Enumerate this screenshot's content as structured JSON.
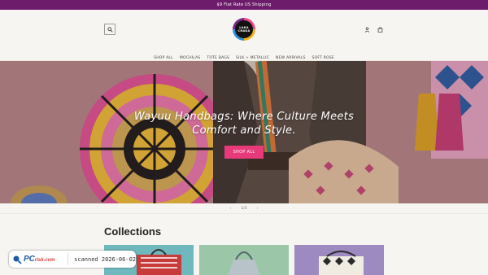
{
  "announcement": "$9 Flat Rate US Shipping",
  "header": {
    "logo_text": [
      "LAKA",
      "CHAKA"
    ],
    "icons": [
      "search-icon",
      "account-icon",
      "cart-icon"
    ]
  },
  "nav": {
    "items": [
      "SHOP ALL",
      "MOCHILAS",
      "TOTE BAGS",
      "SILK + METALLIC",
      "NEW ARRIVALS",
      "SOFT ROSE"
    ]
  },
  "hero": {
    "title_line1": "Wayuu Handbags: Where Culture Meets",
    "title_line2": "Comfort and Style.",
    "button": "SHOP ALL"
  },
  "slider": {
    "prev": "‹",
    "counter": "1/3",
    "next": "›"
  },
  "collections": {
    "title": "Collections"
  },
  "watermark": {
    "brand": "PC",
    "brand_suffix": "risk.com",
    "scan_text": "scanned 2026-06-02"
  },
  "colors": {
    "announcement_bg": "#6d1b6b",
    "button_accent": "#e8397a",
    "page_bg": "#f6f5f1"
  }
}
